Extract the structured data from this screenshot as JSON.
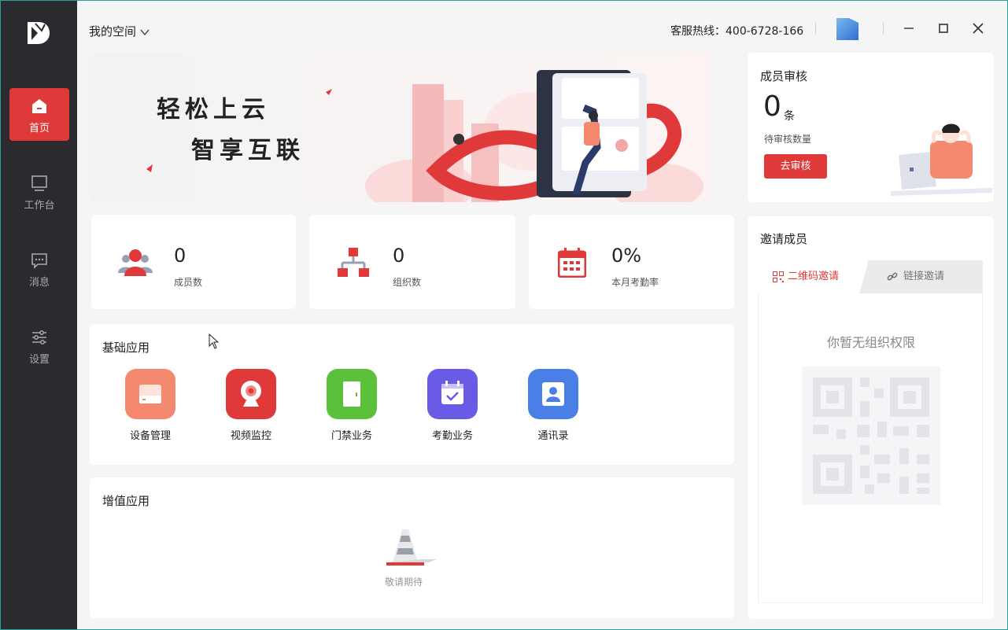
{
  "topbar": {
    "space_label": "我的空间",
    "hotline": "客服热线：400-6728-166"
  },
  "sidebar": {
    "items": [
      {
        "label": "首页",
        "icon": "home-icon"
      },
      {
        "label": "工作台",
        "icon": "monitor-icon"
      },
      {
        "label": "消息",
        "icon": "message-icon"
      },
      {
        "label": "设置",
        "icon": "settings-sliders-icon"
      }
    ]
  },
  "banner": {
    "line1": "轻松上云",
    "line2": "智享互联"
  },
  "stats": [
    {
      "value": "0",
      "label": "成员数",
      "icon": "members-icon"
    },
    {
      "value": "0",
      "label": "组织数",
      "icon": "org-chart-icon"
    },
    {
      "value": "0%",
      "label": "本月考勤率",
      "icon": "calendar-icon"
    }
  ],
  "basic_apps": {
    "title": "基础应用",
    "items": [
      {
        "label": "设备管理",
        "color": "#f4896f",
        "icon": "device-icon"
      },
      {
        "label": "视频监控",
        "color": "#e0393a",
        "icon": "camera-icon"
      },
      {
        "label": "门禁业务",
        "color": "#5bc03a",
        "icon": "door-icon"
      },
      {
        "label": "考勤业务",
        "color": "#6a5be6",
        "icon": "attendance-icon"
      },
      {
        "label": "通讯录",
        "color": "#4a7fe8",
        "icon": "contacts-icon"
      }
    ]
  },
  "value_apps": {
    "title": "增值应用",
    "empty_text": "敬请期待"
  },
  "review": {
    "title": "成员审核",
    "count": "0",
    "unit": "条",
    "desc": "待审核数量",
    "button": "去审核"
  },
  "invite": {
    "title": "邀请成员",
    "tab_qr": "二维码邀请",
    "tab_link": "链接邀请",
    "no_permission": "你暂无组织权限"
  },
  "colors": {
    "accent": "#e0393a",
    "sidebar_bg": "#2b2b2f"
  }
}
